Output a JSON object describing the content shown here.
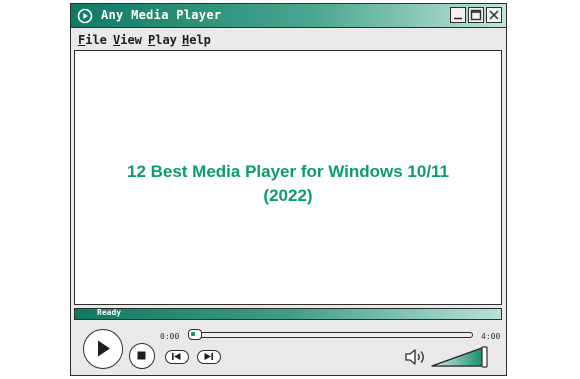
{
  "window": {
    "title": "Any Media Player"
  },
  "menu": [
    {
      "underline": "F",
      "rest": "ile"
    },
    {
      "underline": "V",
      "rest": "iew"
    },
    {
      "underline": "P",
      "rest": "lay"
    },
    {
      "underline": "H",
      "rest": "elp"
    }
  ],
  "viewport": {
    "headline_line1": "12 Best Media Player for Windows 10/11",
    "headline_line2": "(2022)"
  },
  "status": {
    "text": "Ready"
  },
  "playback": {
    "current_time": "0:00",
    "total_time": "4:00",
    "progress": 0.0
  },
  "volume": {
    "level": 1.0
  },
  "colors": {
    "accent": "#0f7a62",
    "headline": "#0e9a70"
  }
}
